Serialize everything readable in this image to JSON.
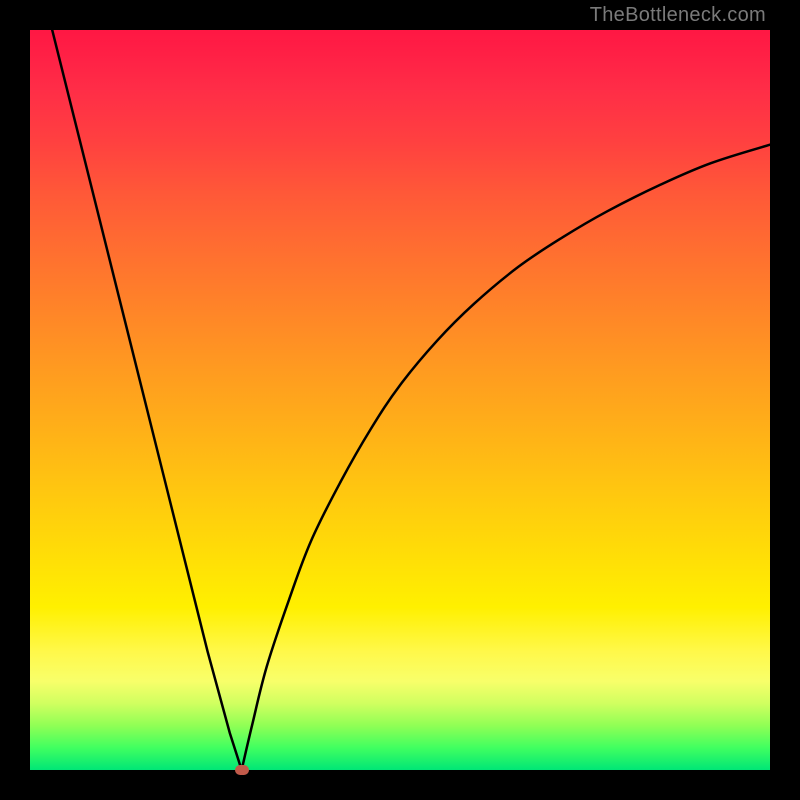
{
  "watermark": "TheBottleneck.com",
  "chart_data": {
    "type": "line",
    "title": "",
    "xlabel": "",
    "ylabel": "",
    "xlim": [
      0,
      100
    ],
    "ylim": [
      0,
      100
    ],
    "series": [
      {
        "name": "left-branch",
        "x": [
          3,
          6,
          9,
          12,
          15,
          18,
          21,
          24,
          27,
          28.6
        ],
        "values": [
          100,
          88,
          76,
          64,
          52,
          40,
          28,
          16,
          5,
          0
        ]
      },
      {
        "name": "right-branch",
        "x": [
          28.6,
          30,
          32,
          35,
          38,
          42,
          46,
          50,
          55,
          60,
          66,
          72,
          78,
          85,
          92,
          100
        ],
        "values": [
          0,
          6,
          14,
          23,
          31,
          39,
          46,
          52,
          58,
          63,
          68,
          72,
          75.5,
          79,
          82,
          84.5
        ]
      }
    ],
    "marker": {
      "x": 28.6,
      "y": 0,
      "color": "#c15a4a"
    },
    "background_gradient": {
      "top": "#ff1744",
      "mid": "#ffc400",
      "bottom": "#00e676"
    },
    "grid": false,
    "legend": false
  }
}
